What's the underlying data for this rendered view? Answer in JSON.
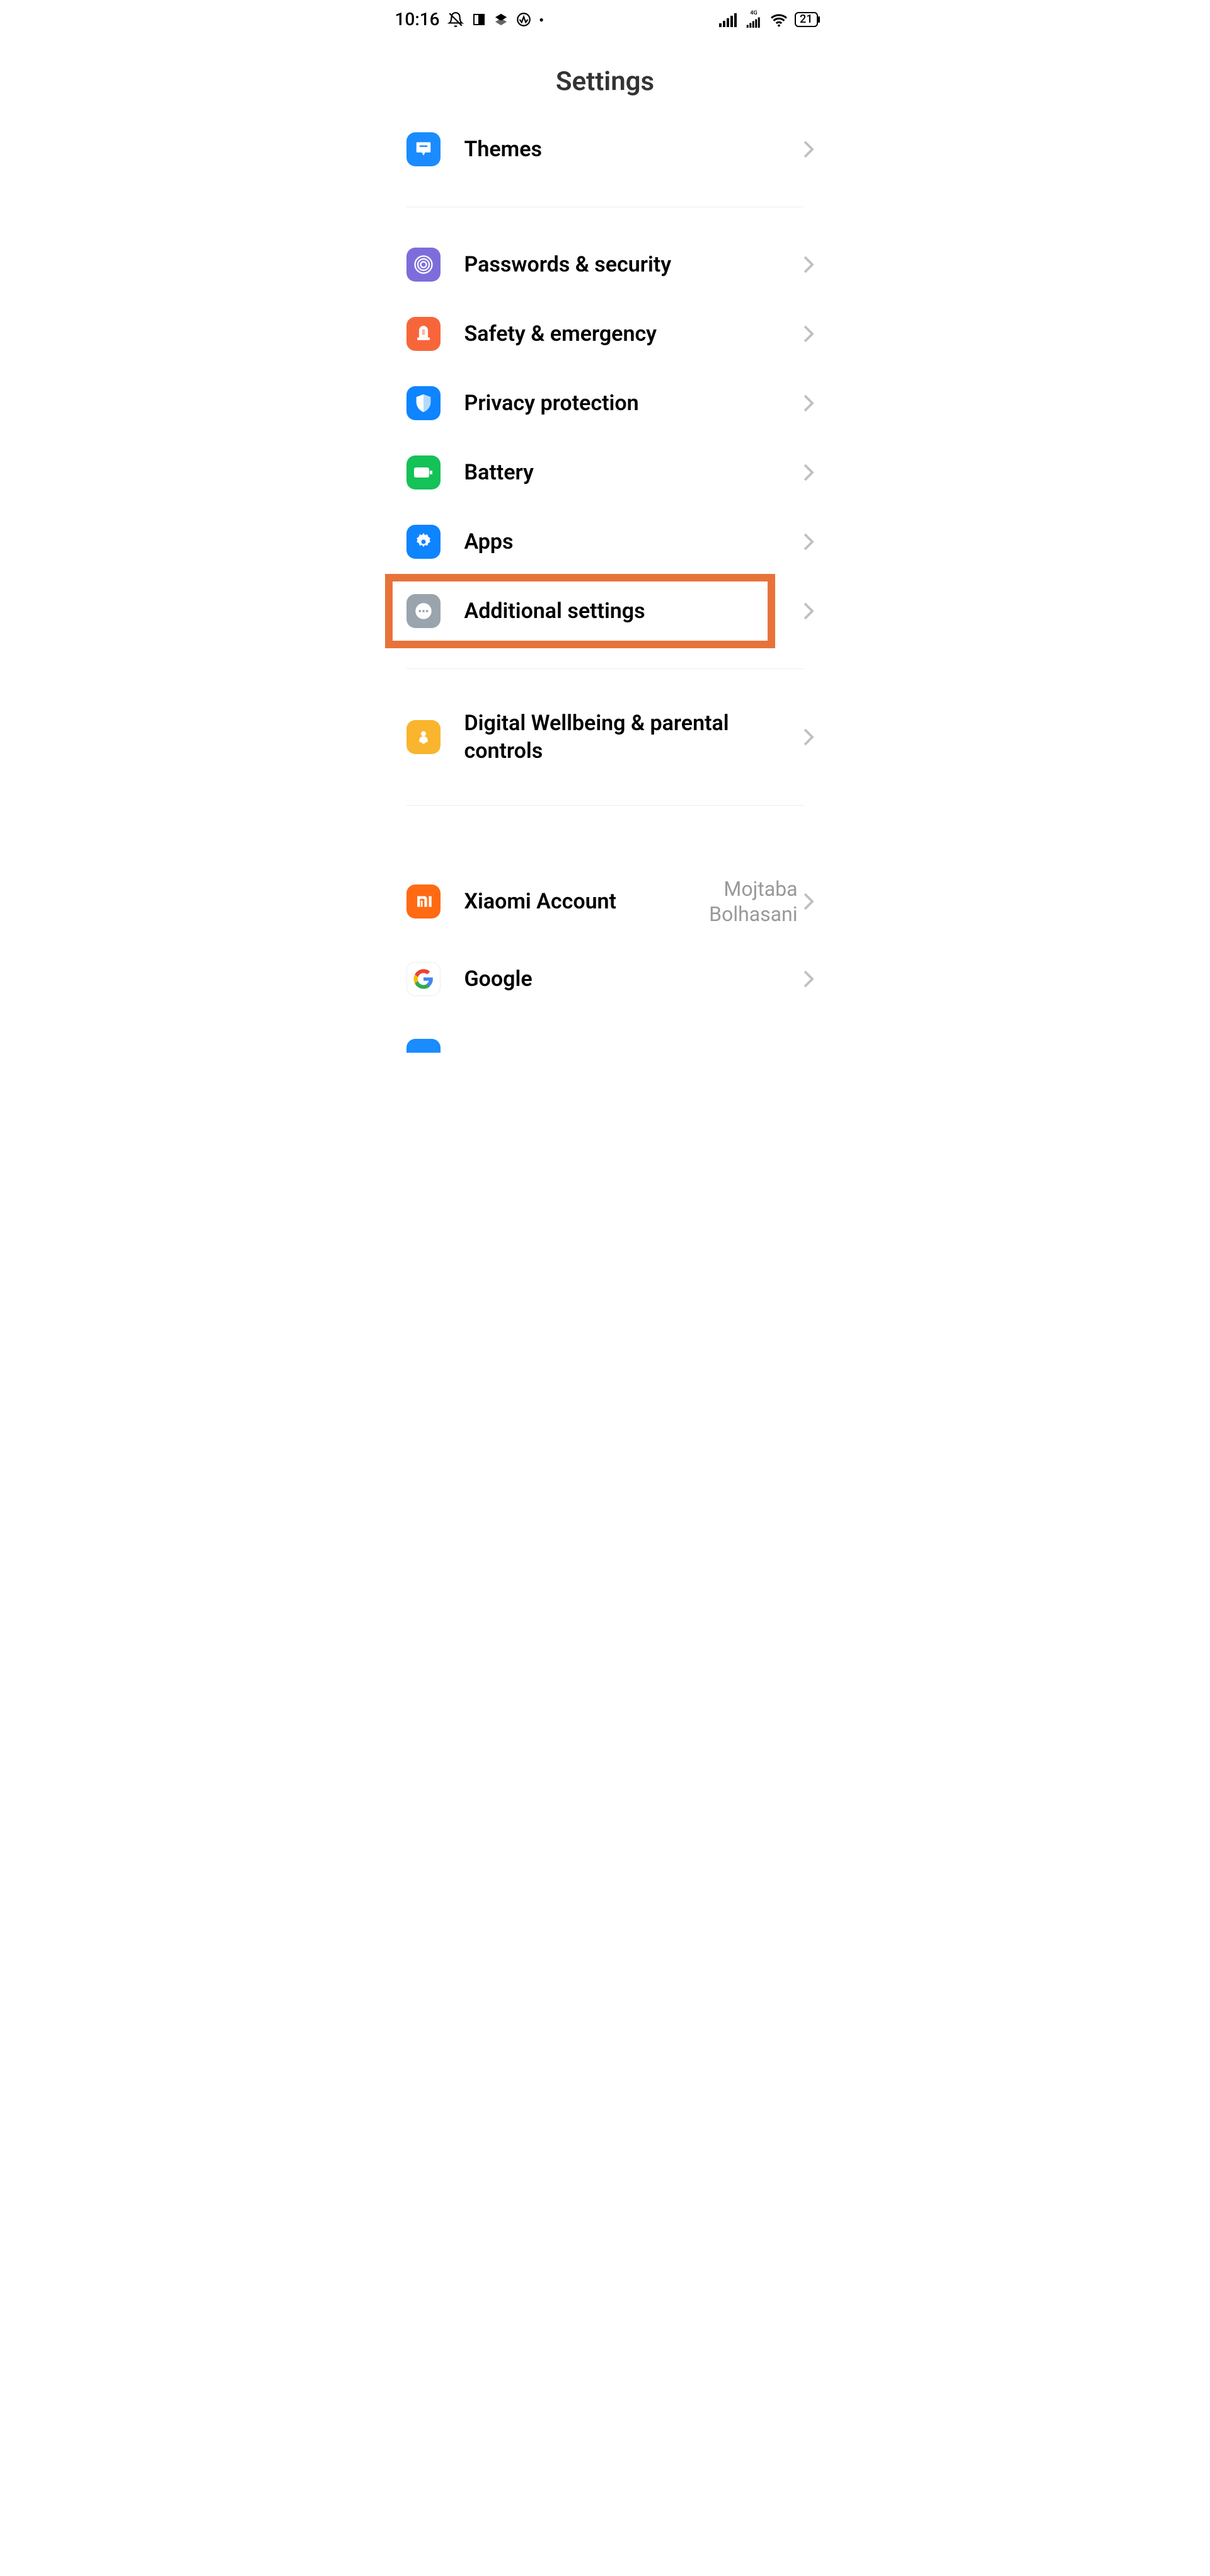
{
  "status_bar": {
    "time": "10:16",
    "battery": "21"
  },
  "page_title": "Settings",
  "items": {
    "themes": "Themes",
    "passwords": "Passwords & security",
    "safety": "Safety & emergency",
    "privacy": "Privacy protection",
    "battery": "Battery",
    "apps": "Apps",
    "additional": "Additional settings",
    "wellbeing": "Digital Wellbeing & parental controls",
    "xiaomi": "Xiaomi Account",
    "xiaomi_value": "Mojtaba\nBolhasani",
    "google": "Google"
  }
}
